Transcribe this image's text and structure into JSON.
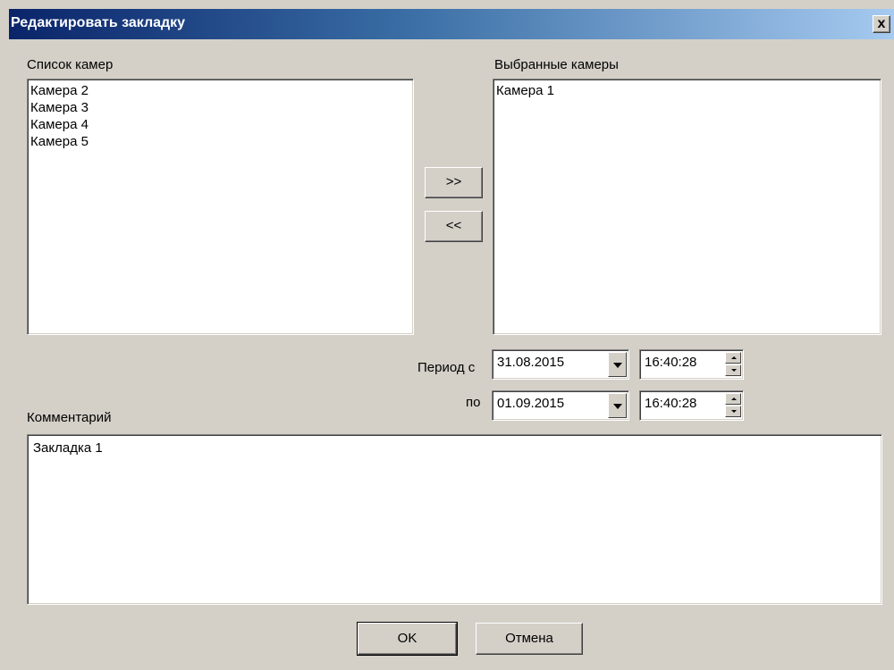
{
  "window": {
    "title": "Редактировать закладку",
    "close_label": "x"
  },
  "camera_list": {
    "label": "Список камер",
    "items": [
      "Камера 2",
      "Камера 3",
      "Камера 4",
      "Камера 5"
    ]
  },
  "selected_cameras": {
    "label": "Выбранные камеры",
    "items": [
      "Камера 1"
    ]
  },
  "transfer": {
    "add_label": ">>",
    "remove_label": "<<"
  },
  "period": {
    "from_label": "Период с",
    "to_label": "по",
    "from_date": "31.08.2015",
    "from_time": "16:40:28",
    "to_date": "01.09.2015",
    "to_time": "16:40:28"
  },
  "comment": {
    "label": "Комментарий",
    "value": "Закладка 1"
  },
  "buttons": {
    "ok_label": "OK",
    "cancel_label": "Отмена"
  },
  "colors": {
    "dialog_bg": "#d4d0c8",
    "title_gradient_start": "#0a246a",
    "title_gradient_end": "#a6caf0"
  }
}
